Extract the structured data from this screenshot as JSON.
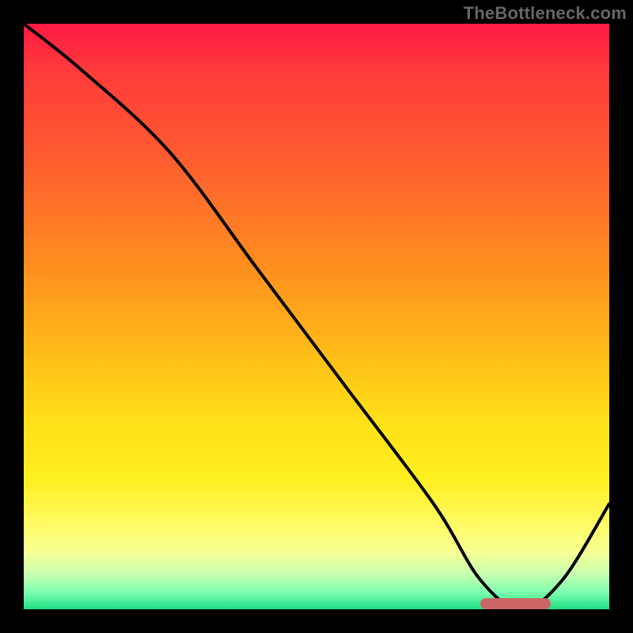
{
  "watermark": "TheBottleneck.com",
  "chart_data": {
    "type": "line",
    "title": "",
    "xlabel": "",
    "ylabel": "",
    "xlim": [
      0,
      100
    ],
    "ylim": [
      0,
      100
    ],
    "series": [
      {
        "name": "curve",
        "x": [
          0,
          10,
          25,
          40,
          55,
          70,
          78,
          85,
          92,
          100
        ],
        "y": [
          100,
          92,
          78,
          58,
          38,
          18,
          5,
          0,
          5,
          18
        ]
      }
    ],
    "marker": {
      "x_start": 78,
      "x_end": 90,
      "y": 1
    },
    "gradient_stops": [
      {
        "pct": 0,
        "color": "#ff1a44"
      },
      {
        "pct": 50,
        "color": "#ffc818"
      },
      {
        "pct": 85,
        "color": "#fff860"
      },
      {
        "pct": 100,
        "color": "#20e084"
      }
    ]
  }
}
